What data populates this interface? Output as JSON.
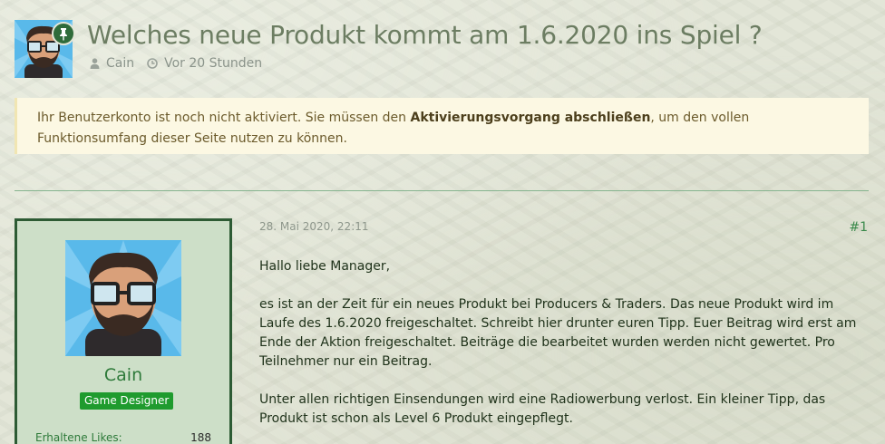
{
  "thread": {
    "title": "Welches neue Produkt kommt am 1.6.2020 ins Spiel ?",
    "author": "Cain",
    "time_ago": "Vor 20 Stunden",
    "icons": {
      "pin": "pin-icon",
      "user": "user-icon",
      "clock": "clock-icon"
    }
  },
  "notice": {
    "text_before": "Ihr Benutzerkonto ist noch nicht aktiviert. Sie müssen den ",
    "link_text": "Aktivierungsvorgang abschließen",
    "text_after": ", um den vollen Funktionsumfang dieser Seite nutzen zu können."
  },
  "post": {
    "date": "28. Mai 2020, 22:11",
    "number": "#1",
    "paragraphs": [
      "Hallo liebe Manager,",
      "es ist an der Zeit für ein neues Produkt bei Producers & Traders. Das neue Produkt wird im Laufe des 1.6.2020 freigeschaltet. Schreibt hier drunter euren Tipp. Euer Beitrag wird erst am Ende der Aktion freigeschaltet. Beiträge die bearbeitet wurden werden nicht gewertet. Pro Teilnehmer nur ein Beitrag.",
      "Unter allen richtigen Einsendungen wird eine Radiowerbung verlost. Ein kleiner Tipp, das Produkt ist schon als Level 6 Produkt eingepflegt."
    ]
  },
  "user": {
    "name": "Cain",
    "rank": "Game Designer",
    "likes_label": "Erhaltene Likes:",
    "likes_value": "188"
  },
  "colors": {
    "accent_green": "#2d5b34",
    "rank_badge": "#1f9b2e",
    "notice_bg": "#fcf8e3",
    "avatar_bg": "#59b9ea"
  }
}
